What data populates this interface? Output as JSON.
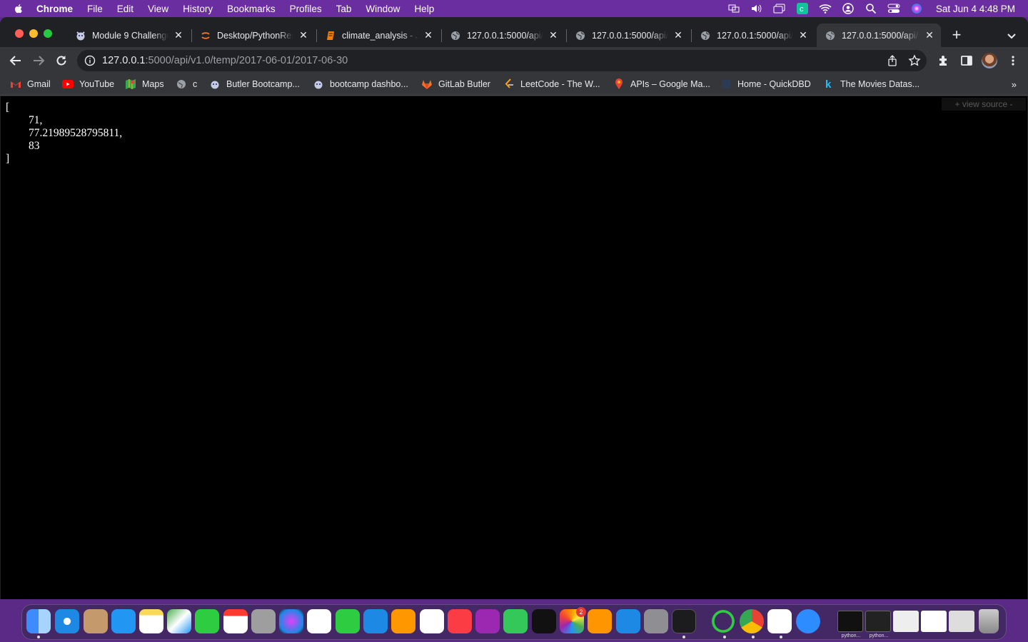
{
  "menubar": {
    "app": "Chrome",
    "items": [
      "File",
      "Edit",
      "View",
      "History",
      "Bookmarks",
      "Profiles",
      "Tab",
      "Window",
      "Help"
    ],
    "clock": "Sat Jun 4  4:48 PM"
  },
  "tabs": [
    {
      "title": "Module 9 Challenge",
      "icon": "bulldog-icon"
    },
    {
      "title": "Desktop/PythonRes",
      "icon": "jupyter-icon"
    },
    {
      "title": "climate_analysis - J",
      "icon": "notebook-icon"
    },
    {
      "title": "127.0.0.1:5000/api/",
      "icon": "globe-icon"
    },
    {
      "title": "127.0.0.1:5000/api/",
      "icon": "globe-icon"
    },
    {
      "title": "127.0.0.1:5000/api/",
      "icon": "globe-icon"
    },
    {
      "title": "127.0.0.1:5000/api/",
      "icon": "globe-icon",
      "active": true
    }
  ],
  "address": {
    "host": "127.0.0.1",
    "path": ":5000/api/v1.0/temp/2017-06-01/2017-06-30"
  },
  "bookmarks": [
    {
      "label": "Gmail",
      "icon": "gmail-icon"
    },
    {
      "label": "YouTube",
      "icon": "youtube-icon"
    },
    {
      "label": "Maps",
      "icon": "maps-icon"
    },
    {
      "label": "c",
      "icon": "globe-icon"
    },
    {
      "label": "Butler Bootcamp...",
      "icon": "bulldog-icon"
    },
    {
      "label": "bootcamp dashbo...",
      "icon": "bulldog-icon"
    },
    {
      "label": "GitLab Butler",
      "icon": "gitlab-icon"
    },
    {
      "label": "LeetCode - The W...",
      "icon": "leetcode-icon"
    },
    {
      "label": "APIs – Google Ma...",
      "icon": "maps-pin-icon"
    },
    {
      "label": "Home - QuickDBD",
      "icon": "quickdbd-icon"
    },
    {
      "label": "The Movies Datas...",
      "icon": "kaggle-icon"
    }
  ],
  "page": {
    "open_bracket": "[",
    "values": [
      "71,",
      "77.21989528795811,",
      "83"
    ],
    "close_bracket": "]",
    "view_source": "+ view source -"
  },
  "dock": {
    "photos_badge": "2",
    "thumb_labels": [
      "python...",
      "python..."
    ]
  }
}
